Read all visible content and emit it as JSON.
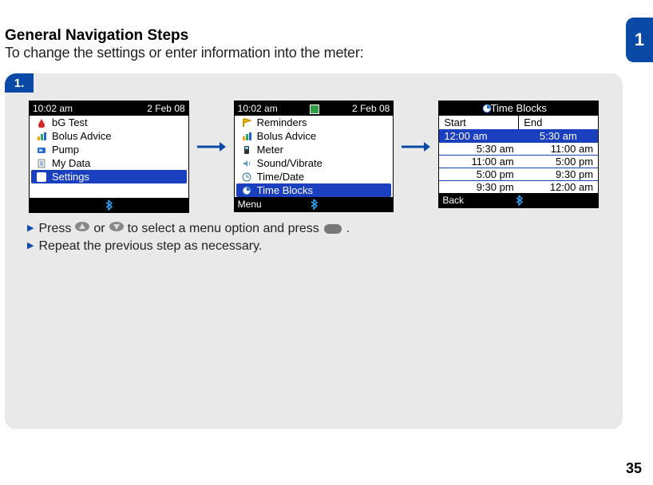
{
  "chapter": "1",
  "page_number": "35",
  "title": "General Navigation Steps",
  "subtitle": "To change the settings or enter information into the meter:",
  "step_label": "1.",
  "screen1": {
    "time": "10:02 am",
    "date": "2 Feb 08",
    "items": [
      "bG Test",
      "Bolus Advice",
      "Pump",
      "My Data",
      "Settings"
    ],
    "selected_index": 4,
    "footer_left": ""
  },
  "screen2": {
    "time": "10:02 am",
    "date": "2 Feb 08",
    "items": [
      "Reminders",
      "Bolus Advice",
      "Meter",
      "Sound/Vibrate",
      "Time/Date",
      "Time Blocks"
    ],
    "selected_index": 5,
    "footer_left": "Menu"
  },
  "screen3": {
    "title": "Time Blocks",
    "col1": "Start",
    "col2": "End",
    "rows": [
      {
        "start": "12:00 am",
        "end": "5:30 am"
      },
      {
        "start": "5:30 am",
        "end": "11:00 am"
      },
      {
        "start": "11:00 am",
        "end": "5:00 pm"
      },
      {
        "start": "5:00 pm",
        "end": "9:30 pm"
      },
      {
        "start": "9:30 pm",
        "end": "12:00 am"
      }
    ],
    "selected_index": 0,
    "footer_left": "Back"
  },
  "instructions": {
    "line1_a": "Press",
    "line1_b": "or",
    "line1_c": "to select a menu option and press",
    "line1_d": ".",
    "line2": "Repeat the previous step as necessary."
  }
}
